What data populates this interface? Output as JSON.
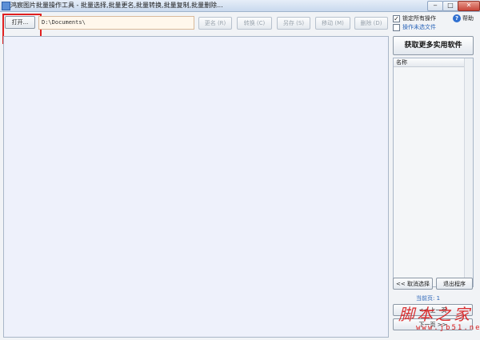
{
  "window": {
    "title": "鸿宸图片批量操作工具 - 批量选择,批量更名,批量转换,批量复制,批量删除...",
    "minimize_label": "‒",
    "maximize_label": "□",
    "close_label": "✕"
  },
  "toolbar": {
    "open_label": "打开...",
    "path_value": "D:\\Documents\\",
    "rename_label": "更名 (R)",
    "convert_label": "转换 (C)",
    "saveas_label": "另存 (S)",
    "move_label": "移动 (M)",
    "delete_label": "删除 (D)"
  },
  "options": {
    "lock_all_label": "锁定所有操作",
    "lock_all_checked": true,
    "op_unselected_label": "操作未选文件",
    "op_unselected_checked": false,
    "check_mark": "✓",
    "help_label": "帮助",
    "help_icon_glyph": "?"
  },
  "side": {
    "get_more_label": "获取更多实用软件",
    "list_header_name": "名称",
    "cancel_select_label": "<< 取消选择",
    "exit_label": "退出程序",
    "page_label": "当前页: 1",
    "prev_label": "<< 上一页",
    "next_label": "下一页 >>"
  },
  "watermark": {
    "text": "脚本之家",
    "url": "www.jb51.net"
  },
  "colors": {
    "accent_red": "#e02020",
    "content_bg": "#eef1fb",
    "page_info": "#2a64b8"
  }
}
